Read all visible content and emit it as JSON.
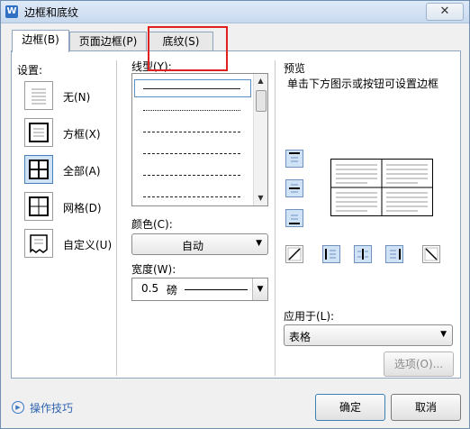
{
  "window": {
    "title": "边框和底纹",
    "app_icon_letter": "W",
    "close_symbol": "✕"
  },
  "tabs": [
    {
      "label": "边框(B)",
      "active": true
    },
    {
      "label": "页面边框(P)",
      "active": false
    },
    {
      "label": "底纹(S)",
      "active": false
    }
  ],
  "settings": {
    "heading": "设置:",
    "items": [
      {
        "label": "无(N)"
      },
      {
        "label": "方框(X)"
      },
      {
        "label": "全部(A)",
        "selected": true
      },
      {
        "label": "网格(D)"
      },
      {
        "label": "自定义(U)"
      }
    ]
  },
  "line_style": {
    "label": "线型(Y):"
  },
  "color": {
    "label": "颜色(C):",
    "value": "自动"
  },
  "width": {
    "label": "宽度(W):",
    "value": "0.5",
    "unit": "磅"
  },
  "preview": {
    "heading": "预览",
    "hint": "单击下方图示或按钮可设置边框"
  },
  "apply_to": {
    "label": "应用于(L):",
    "value": "表格"
  },
  "buttons": {
    "options": "选项(O)...",
    "ok": "确定",
    "cancel": "取消"
  },
  "help": {
    "label": "操作技巧"
  },
  "colors": {
    "accent": "#4a7fb8",
    "highlight": "#e0201f"
  }
}
